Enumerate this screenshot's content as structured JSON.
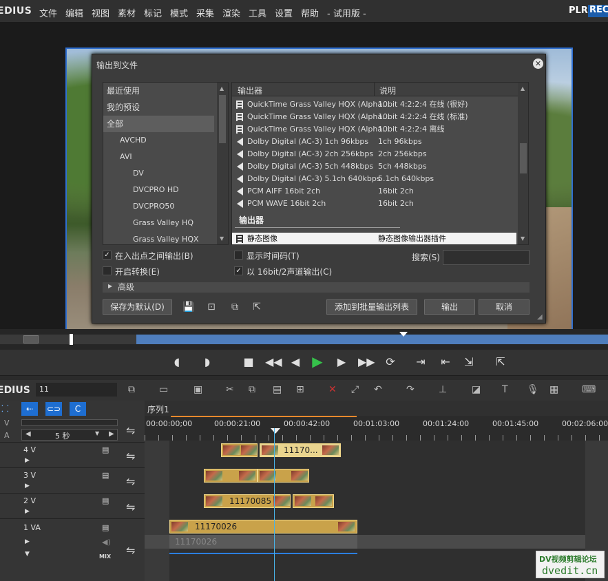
{
  "menu": {
    "logo": "EDIUS",
    "items": [
      "文件",
      "编辑",
      "视图",
      "素材",
      "标记",
      "模式",
      "采集",
      "渲染",
      "工具",
      "设置",
      "帮助"
    ],
    "edition": "- 试用版 -",
    "plr": "PLR",
    "rec": "REC"
  },
  "dialog": {
    "title": "输出到文件",
    "left_items": [
      "最近使用",
      "我的预设",
      "全部",
      "AVCHD",
      "AVI",
      "DV",
      "DVCPRO HD",
      "DVCPRO50",
      "Grass Valley HQ",
      "Grass Valley HQX"
    ],
    "left_selected": "全部",
    "col_exporter": "输出器",
    "col_desc": "说明",
    "rows": [
      {
        "icon": "film",
        "name": "QuickTime Grass Valley HQX (Alpha...",
        "desc": "10bit 4:2:2:4 在线 (很好)"
      },
      {
        "icon": "film",
        "name": "QuickTime Grass Valley HQX (Alpha...",
        "desc": "10bit 4:2:2:4 在线 (标准)"
      },
      {
        "icon": "film",
        "name": "QuickTime Grass Valley HQX (Alpha...",
        "desc": "10bit 4:2:2:4 离线"
      },
      {
        "icon": "speaker",
        "name": "Dolby Digital (AC-3) 1ch 96kbps",
        "desc": "1ch 96kbps"
      },
      {
        "icon": "speaker",
        "name": "Dolby Digital (AC-3) 2ch 256kbps",
        "desc": "2ch 256kbps"
      },
      {
        "icon": "speaker",
        "name": "Dolby Digital (AC-3) 5ch 448kbps",
        "desc": "5ch 448kbps"
      },
      {
        "icon": "speaker",
        "name": "Dolby Digital (AC-3) 5.1ch 640kbps",
        "desc": "5.1ch 640kbps"
      },
      {
        "icon": "speaker",
        "name": "PCM AIFF 16bit 2ch",
        "desc": "16bit 2ch"
      },
      {
        "icon": "speaker",
        "name": "PCM WAVE 16bit 2ch",
        "desc": "16bit 2ch"
      }
    ],
    "section_label": "输出器",
    "selected_row": {
      "name": "静态图像",
      "desc": "静态图像输出器插件"
    },
    "opt_inout": "在入出点之间输出(B)",
    "opt_convert": "开启转换(E)",
    "opt_timecode": "显示时间码(T)",
    "opt_16bit": "以 16bit/2声道输出(C)",
    "search_label": "搜索(S)",
    "search_value": "",
    "advanced": "高级",
    "btn_save_default": "保存为默认(D)",
    "btn_add_batch": "添加到批量输出列表",
    "btn_export": "输出",
    "btn_cancel": "取消"
  },
  "timeline": {
    "logo": "EDIUS",
    "project": "11",
    "sequence_tab": "序列1",
    "zoom": "5 秒",
    "ruler": [
      "00:00:00;00",
      "00:00:21:00",
      "00:00:42:00",
      "00:01:03:00",
      "00:01:24:00",
      "00:01:45:00",
      "00:02:06:00"
    ],
    "tracks": [
      "4 V",
      "3 V",
      "2 V",
      "1 VA"
    ],
    "clip_4v": "11170...",
    "clip_2v": "11170085",
    "clip_1va": "11170026",
    "clip_1va_audio": "11170026",
    "mix": "MIX",
    "v_label": "V",
    "a_label": "A"
  },
  "watermark": {
    "line1": "DV视频剪辑论坛",
    "line2": "dvedit.cn"
  }
}
